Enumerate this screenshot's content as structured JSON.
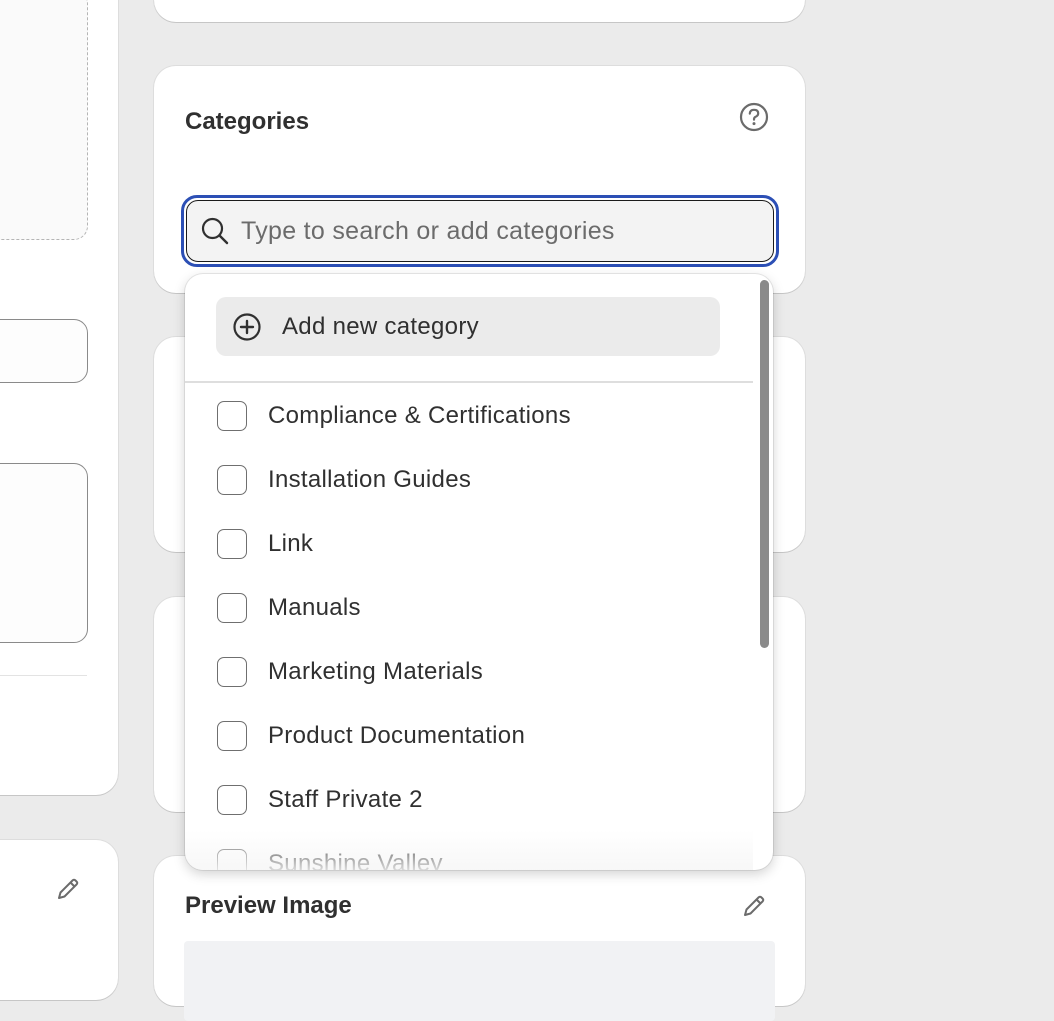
{
  "categories_card": {
    "title": "Categories",
    "search": {
      "placeholder": "Type to search or add categories",
      "value": ""
    }
  },
  "dropdown": {
    "add_new_label": "Add new category",
    "options": [
      {
        "label": "Compliance & Certifications",
        "checked": false
      },
      {
        "label": "Installation Guides",
        "checked": false
      },
      {
        "label": "Link",
        "checked": false
      },
      {
        "label": "Manuals",
        "checked": false
      },
      {
        "label": "Marketing Materials",
        "checked": false
      },
      {
        "label": "Product Documentation",
        "checked": false
      },
      {
        "label": "Staff Private 2",
        "checked": false
      },
      {
        "label": "Sunshine Valley",
        "checked": false
      }
    ]
  },
  "preview_card": {
    "title": "Preview Image"
  },
  "icons": {
    "help": "help-circle-icon",
    "search": "search-icon",
    "add": "plus-circle-icon",
    "edit": "pencil-icon"
  },
  "colors": {
    "focus_ring": "#2c4fb5",
    "page_background": "#ebebeb",
    "card_background": "#ffffff",
    "add_row_background": "#ebebeb",
    "scrollbar": "#8a8a8a"
  }
}
